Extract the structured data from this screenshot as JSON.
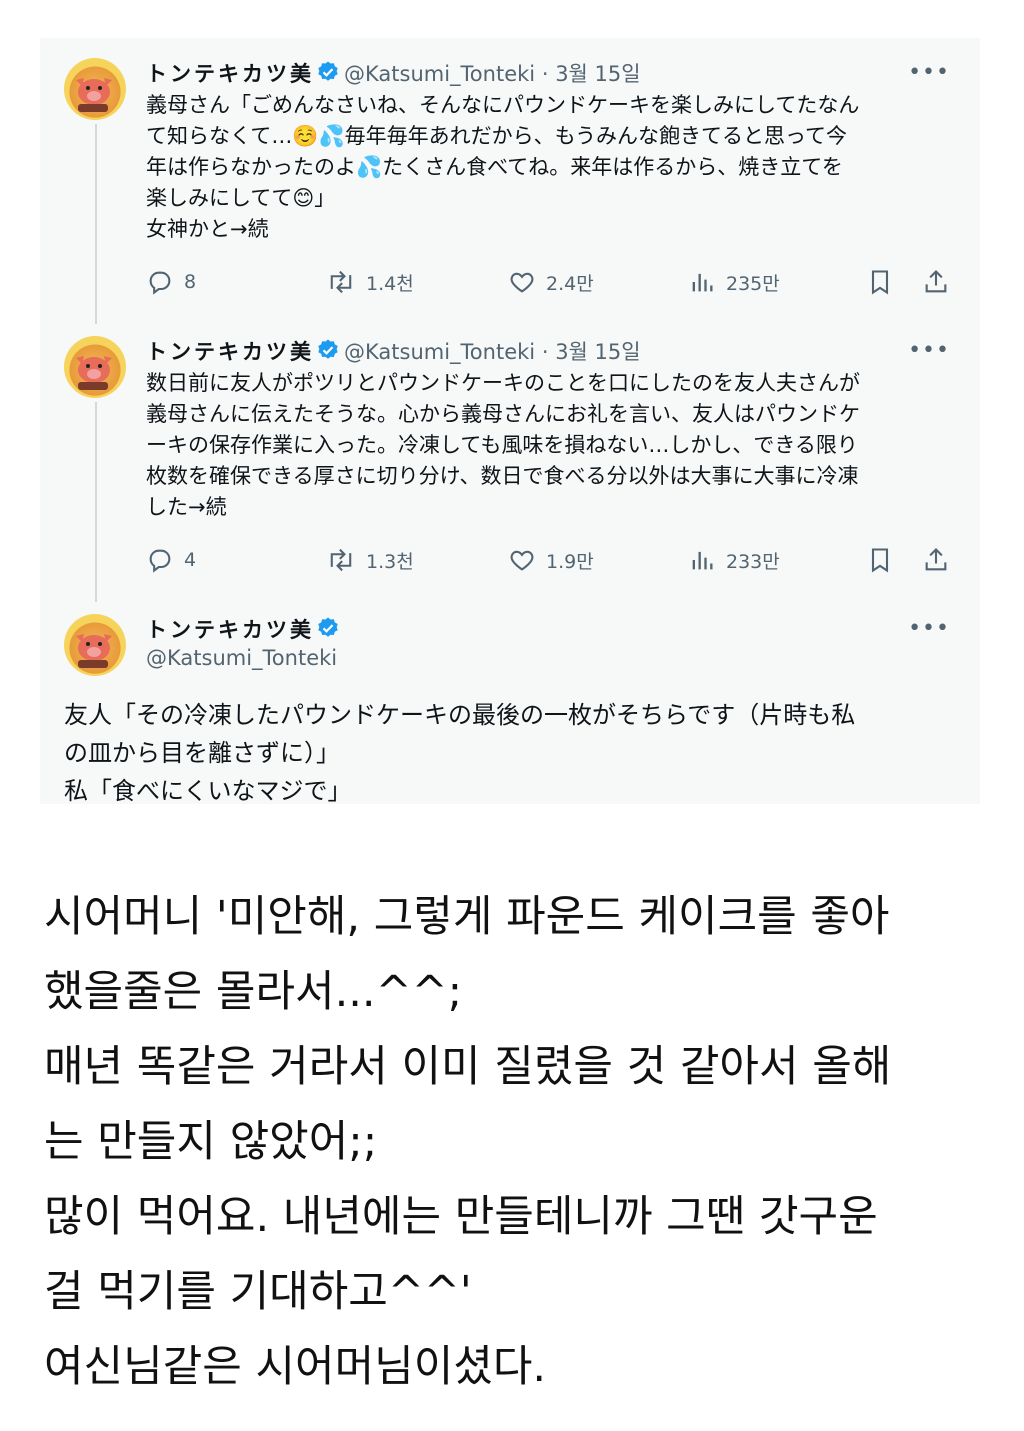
{
  "tweets": [
    {
      "display_name": "トンテキカツ美",
      "handle": "@Katsumi_Tonteki",
      "separator": "·",
      "date": "3월 15일",
      "more": "•••",
      "text": "義母さん「ごめんなさいね、そんなにパウンドケーキを楽しみにしてたなん\nて知らなくて…☺️💦毎年毎年あれだから、もうみんな飽きてると思って今\n年は作らなかったのよ💦たくさん食べてね。来年は作るから、焼き立てを\n楽しみにしてて😊」\n女神かと→続",
      "replies": "8",
      "retweets": "1.4천",
      "likes": "2.4만",
      "views": "235만"
    },
    {
      "display_name": "トンテキカツ美",
      "handle": "@Katsumi_Tonteki",
      "separator": "·",
      "date": "3월 15일",
      "more": "•••",
      "text": "数日前に友人がポツリとパウンドケーキのことを口にしたのを友人夫さんが\n義母さんに伝えたそうな。心から義母さんにお礼を言い、友人はパウンドケ\nーキの保存作業に入った。冷凍しても風味を損ねない…しかし、できる限り\n枚数を確保できる厚さに切り分け、数日で食べる分以外は大事に大事に冷凍\nした→続",
      "replies": "4",
      "retweets": "1.3천",
      "likes": "1.9만",
      "views": "233만"
    },
    {
      "display_name": "トンテキカツ美",
      "handle": "@Katsumi_Tonteki",
      "more": "•••",
      "text": "友人「その冷凍したパウンドケーキの最後の一枚がそちらです（片時も私\nの皿から目を離さずに）」\n私「食べにくいなマジで」"
    }
  ],
  "caption": "시어머니 '미안해, 그렇게 파운드 케이크를 좋아\n했을줄은 몰라서...^^;\n매년 똑같은 거라서 이미 질렸을 것 같아서 올해\n는 만들지 않았어;;\n많이 먹어요. 내년에는 만들테니까 그땐 갓구운\n걸 먹기를 기대하고^^'\n여신님같은 시어머님이셨다.",
  "colors": {
    "verified": "#1d9bf0",
    "muted": "#536471",
    "text": "#0f1419",
    "thread_line": "#cfd9de"
  },
  "icons": [
    "avatar-pig",
    "verified-badge-icon",
    "more-icon",
    "reply-icon",
    "retweet-icon",
    "like-icon",
    "views-icon",
    "bookmark-icon",
    "share-icon"
  ]
}
